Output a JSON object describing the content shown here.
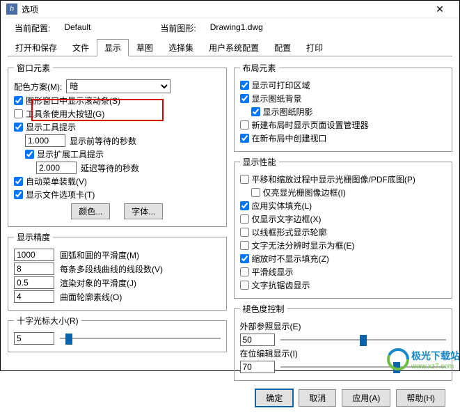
{
  "window": {
    "title": "选项",
    "icon_label": "h"
  },
  "header": {
    "current_config_label": "当前配置:",
    "current_config_value": "Default",
    "current_drawing_label": "当前图形:",
    "current_drawing_value": "Drawing1.dwg"
  },
  "tabs": [
    "打开和保存",
    "文件",
    "显示",
    "草图",
    "选择集",
    "用户系统配置",
    "配置",
    "打印"
  ],
  "active_tab": "显示",
  "left": {
    "window_elements": {
      "legend": "窗口元素",
      "color_scheme_label": "配色方案(M):",
      "color_scheme_value": "暗",
      "cb_scrollbar": "图形窗口中显示滚动条(S)",
      "cb_large_buttons": "工具条使用大按钮(G)",
      "cb_tooltips": "显示工具提示",
      "secs_before_show_value": "1.000",
      "secs_before_show_label": "显示前等待的秒数",
      "cb_ext_tooltips": "显示扩展工具提示",
      "delay_secs_value": "2.000",
      "delay_secs_label": "延迟等待的秒数",
      "cb_auto_menu_load": "自动菜单装载(V)",
      "cb_show_file_tabs": "显示文件选项卡(T)",
      "btn_colors": "颜色...",
      "btn_fonts": "字体..."
    },
    "display_precision": {
      "legend": "显示精度",
      "arc_smooth_value": "1000",
      "arc_smooth_label": "圆弧和圆的平滑度(M)",
      "polyline_segs_value": "8",
      "polyline_segs_label": "每条多段线曲线的线段数(V)",
      "render_smooth_value": "0.5",
      "render_smooth_label": "渲染对象的平滑度(J)",
      "surface_contour_value": "4",
      "surface_contour_label": "曲面轮廓素线(O)"
    },
    "crosshair": {
      "legend": "十字光标大小(R)",
      "value": "5"
    }
  },
  "right": {
    "layout_elements": {
      "legend": "布局元素",
      "cb_print_area": "显示可打印区域",
      "cb_paper_bg": "显示图纸背景",
      "cb_paper_shadow": "显示图纸阴影",
      "cb_page_setup_mgr": "新建布局时显示页面设置管理器",
      "cb_create_viewport": "在新布局中创建视口"
    },
    "display_perf": {
      "legend": "显示性能",
      "cb_pan_zoom_raster": "平移和缩放过程中显示光栅图像/PDF底图(P)",
      "cb_highlight_raster_only": "仅亮显光栅图像边框(I)",
      "cb_solid_fill": "应用实体填充(L)",
      "cb_text_frame_only": "仅显示文字边框(X)",
      "cb_wireframe_silhouette": "以线框形式显示轮廓",
      "cb_dashed_unresolved": "文字无法分辨时显示为框(E)",
      "cb_no_fill_on_zoom": "缩放时不显示填充(Z)",
      "cb_smooth_line": "平滑线显示",
      "cb_antialias_text": "文字抗锯齿显示"
    },
    "fade_control": {
      "legend": "褪色度控制",
      "xref_label": "外部参照显示(E)",
      "xref_value": "50",
      "inplace_label": "在位编辑显示(I)",
      "inplace_value": "70"
    }
  },
  "footer": {
    "ok": "确定",
    "cancel": "取消",
    "apply": "应用(A)",
    "help": "帮助(H)"
  },
  "watermark": {
    "main": "极光下载站",
    "sub": "www.xz7.com"
  }
}
